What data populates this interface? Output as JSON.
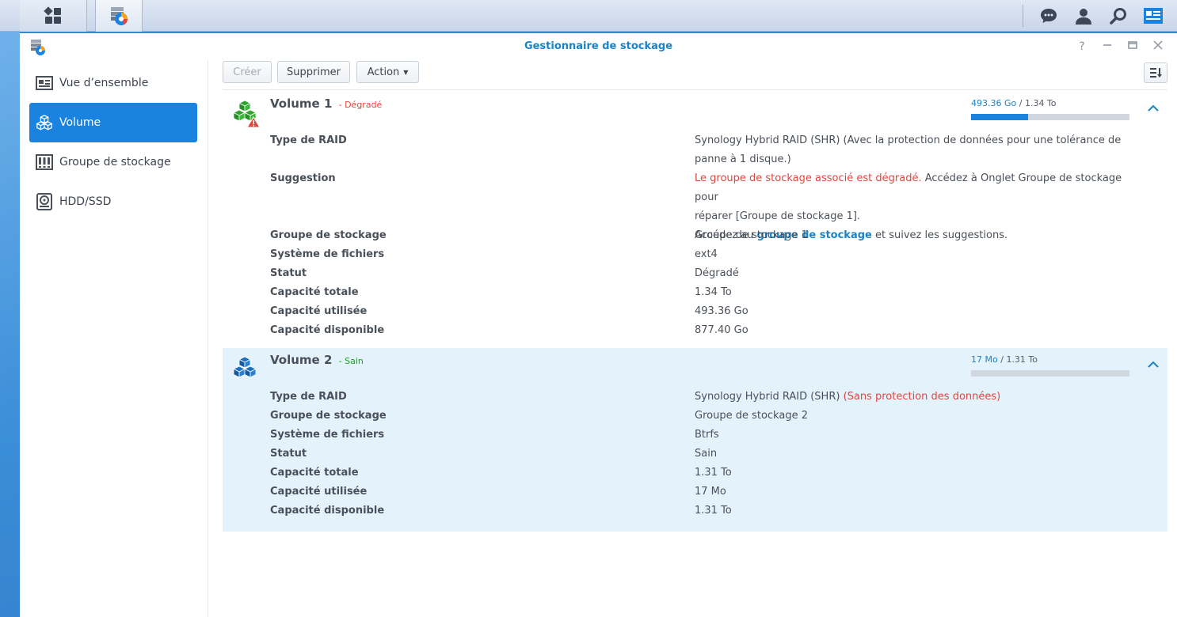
{
  "window": {
    "title": "Gestionnaire de stockage"
  },
  "sidebar": {
    "items": [
      {
        "label": "Vue d’ensemble",
        "icon": "overview-icon"
      },
      {
        "label": "Volume",
        "icon": "cubes-icon",
        "active": true
      },
      {
        "label": "Groupe de stockage",
        "icon": "storage-pool-icon"
      },
      {
        "label": "HDD/SSD",
        "icon": "disk-icon"
      }
    ]
  },
  "toolbar": {
    "create_label": "Créer",
    "delete_label": "Supprimer",
    "action_label": "Action"
  },
  "colors": {
    "accent": "#1a83e0",
    "danger": "#e0463d",
    "success": "#1aa21a",
    "selected_bg": "#e4f2fc"
  },
  "volumes": [
    {
      "name": "Volume 1",
      "status_label": "- Dégradé",
      "usage_used": "493.36 Go",
      "usage_total": "1.34 To",
      "usage_fraction": 0.36,
      "raid_key": "Type de RAID",
      "raid_value_line1": "Synology Hybrid RAID (SHR) (Avec la protection de données pour une tolérance de",
      "raid_value_line2": "panne à 1 disque.)",
      "suggestion_key": "Suggestion",
      "suggestion_red": "Le groupe de stockage associé est dégradé.",
      "suggestion_rest": " Accédez à Onglet Groupe de stockage pour",
      "suggestion_line2": "réparer [Groupe de stockage 1].",
      "suggestion_line3_pre": "Accédez au ",
      "suggestion_link": "groupe de stockage",
      "suggestion_line3_post": " et suivez les suggestions.",
      "pool_key": "Groupe de stockage",
      "pool_value": "Groupe de stockage 1",
      "fs_key": "Système de fichiers",
      "fs_value": "ext4",
      "status_key": "Statut",
      "status_value": "Dégradé",
      "total_key": "Capacité totale",
      "total_value": "1.34 To",
      "used_key": "Capacité utilisée",
      "used_value": "493.36 Go",
      "free_key": "Capacité disponible",
      "free_value": "877.40 Go"
    },
    {
      "name": "Volume 2",
      "status_label": "- Sain",
      "usage_used": "17 Mo",
      "usage_total": "1.31 To",
      "usage_fraction": 0.0,
      "raid_key": "Type de RAID",
      "raid_value": "Synology Hybrid RAID (SHR) ",
      "raid_note": "(Sans protection des données)",
      "pool_key": "Groupe de stockage",
      "pool_value": "Groupe de stockage 2",
      "fs_key": "Système de fichiers",
      "fs_value": "Btrfs",
      "status_key": "Statut",
      "status_value": "Sain",
      "total_key": "Capacité totale",
      "total_value": "1.31 To",
      "used_key": "Capacité utilisée",
      "used_value": "17 Mo",
      "free_key": "Capacité disponible",
      "free_value": "1.31 To"
    }
  ]
}
